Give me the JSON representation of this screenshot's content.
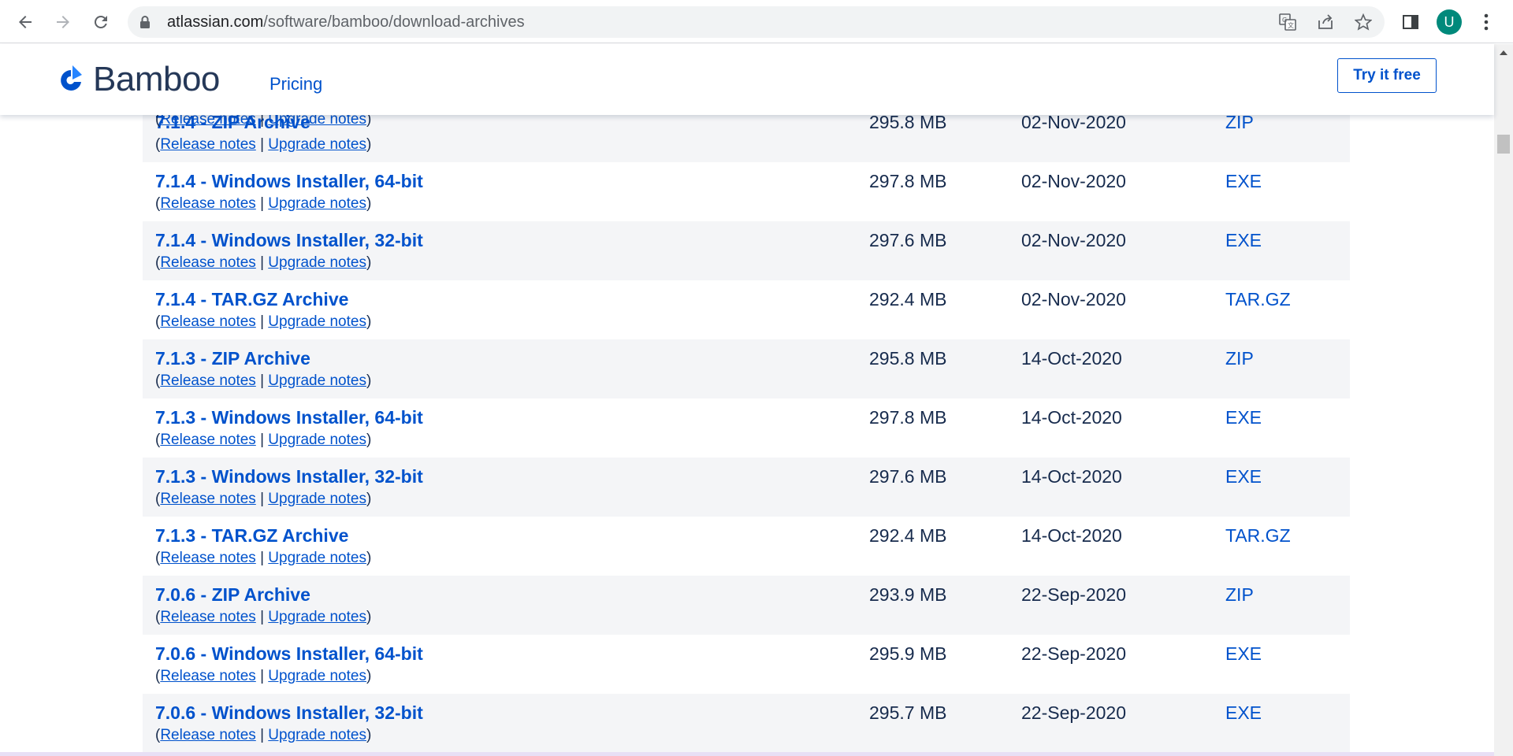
{
  "browser": {
    "url_host": "atlassian.com",
    "url_path": "/software/bamboo/download-archives",
    "avatar_letter": "U"
  },
  "header": {
    "logo_text": "Bamboo",
    "nav_pricing": "Pricing",
    "try_button": "Try it free"
  },
  "notes_labels": {
    "open": "(",
    "release": "Release notes",
    "sep": " | ",
    "upgrade": "Upgrade notes",
    "close": ")"
  },
  "rows": [
    {
      "title": "7.1.4 - ZIP Archive",
      "size": "295.8 MB",
      "date": "02-Nov-2020",
      "type": "ZIP"
    },
    {
      "title": "7.1.4 - Windows Installer, 64-bit",
      "size": "297.8 MB",
      "date": "02-Nov-2020",
      "type": "EXE"
    },
    {
      "title": "7.1.4 - Windows Installer, 32-bit",
      "size": "297.6 MB",
      "date": "02-Nov-2020",
      "type": "EXE"
    },
    {
      "title": "7.1.4 - TAR.GZ Archive",
      "size": "292.4 MB",
      "date": "02-Nov-2020",
      "type": "TAR.GZ"
    },
    {
      "title": "7.1.3 - ZIP Archive",
      "size": "295.8 MB",
      "date": "14-Oct-2020",
      "type": "ZIP"
    },
    {
      "title": "7.1.3 - Windows Installer, 64-bit",
      "size": "297.8 MB",
      "date": "14-Oct-2020",
      "type": "EXE"
    },
    {
      "title": "7.1.3 - Windows Installer, 32-bit",
      "size": "297.6 MB",
      "date": "14-Oct-2020",
      "type": "EXE"
    },
    {
      "title": "7.1.3 - TAR.GZ Archive",
      "size": "292.4 MB",
      "date": "14-Oct-2020",
      "type": "TAR.GZ"
    },
    {
      "title": "7.0.6 - ZIP Archive",
      "size": "293.9 MB",
      "date": "22-Sep-2020",
      "type": "ZIP"
    },
    {
      "title": "7.0.6 - Windows Installer, 64-bit",
      "size": "295.9 MB",
      "date": "22-Sep-2020",
      "type": "EXE"
    },
    {
      "title": "7.0.6 - Windows Installer, 32-bit",
      "size": "295.7 MB",
      "date": "22-Sep-2020",
      "type": "EXE"
    }
  ]
}
